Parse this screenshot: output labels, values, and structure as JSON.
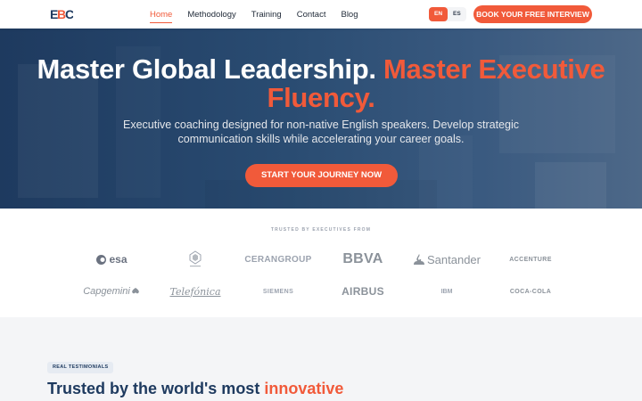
{
  "nav": {
    "logo_text": "EBC",
    "links": [
      {
        "label": "Home",
        "active": true
      },
      {
        "label": "Methodology",
        "active": false
      },
      {
        "label": "Training",
        "active": false
      },
      {
        "label": "Contact",
        "active": false
      },
      {
        "label": "Blog",
        "active": false
      }
    ],
    "languages": [
      "EN",
      "ES"
    ],
    "selected_language": "EN",
    "cta_label": "BOOK YOUR FREE INTERVIEW"
  },
  "hero": {
    "title_main": "Master Global Leadership.",
    "title_accent": "Master Executive Fluency.",
    "subtitle": "Executive coaching designed for non-native English speakers. Develop strategic communication skills while accelerating your career goals.",
    "cta_label": "START YOUR JOURNEY NOW"
  },
  "trusted": {
    "label": "TRUSTED BY EXECUTIVES FROM",
    "logos_row1": [
      "esa",
      "",
      "CERAN",
      "BBVA",
      "Santander",
      "ACCENTURE"
    ],
    "ceran_tag": "GROUP",
    "logos_row2": [
      "Capgemini",
      "Telefónica",
      "SIEMENS",
      "AIRBUS",
      "IBM",
      "COCA-COLA"
    ]
  },
  "testimonials": {
    "badge": "REAL TESTIMONIALS",
    "title_main": "Trusted by the world's most",
    "title_accent": "innovative"
  },
  "colors": {
    "accent": "#f15a3a",
    "navy": "#1e3a5f",
    "logo_gray": "#8b929a"
  }
}
